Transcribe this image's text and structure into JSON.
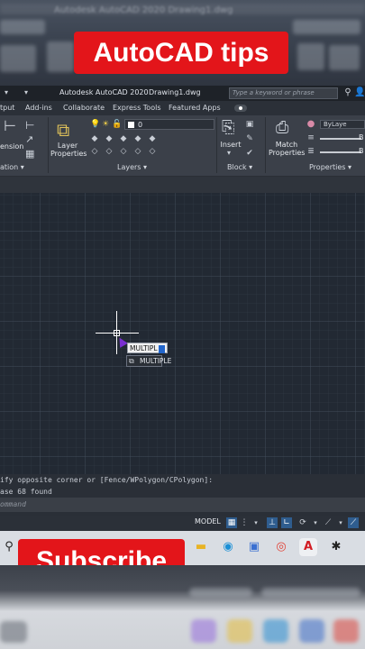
{
  "banner_top": {
    "text": "AutoCAD tips"
  },
  "banner_bottom": {
    "text": "Subscribe"
  },
  "background_blur": {
    "title": "Autodesk AutoCAD 2020  Drawing1.dwg"
  },
  "titlebar": {
    "app_title": "Autodesk AutoCAD 2020",
    "file_name": "Drawing1.dwg",
    "search_placeholder": "Type a keyword or phrase"
  },
  "ribbon_tabs": [
    {
      "label": "tput"
    },
    {
      "label": "Add-ins"
    },
    {
      "label": "Collaborate"
    },
    {
      "label": "Express Tools"
    },
    {
      "label": "Featured Apps"
    }
  ],
  "ribbon": {
    "dimension_label": "ension",
    "annotation_footer": "ation",
    "layer_properties_label_1": "Layer",
    "layer_properties_label_2": "Properties",
    "layer_value": "0",
    "layers_footer": "Layers",
    "insert_label": "Insert",
    "block_footer": "Block",
    "match_properties_label_1": "Match",
    "match_properties_label_2": "Properties",
    "bylayer_value": "ByLaye",
    "prop_b1": "B",
    "prop_b2": "B",
    "properties_footer": "Properties"
  },
  "drawing": {
    "dynamic_input_text": "MULTIPL",
    "autocomplete_item": "MULTIPLE"
  },
  "command": {
    "history_line_1": "ify opposite corner or [Fence/WPolygon/CPolygon]:",
    "history_line_2": "ase 68 found",
    "input_placeholder": "ommand"
  },
  "statusbar": {
    "model_label": "MODEL"
  },
  "colors": {
    "banner_red": "#e3151a",
    "ribbon_bg": "#3b4049",
    "canvas_bg": "#222933",
    "cursor_purple": "#7a2fd0"
  },
  "taskbar_icons": [
    "search-icon",
    "file-explorer-icon",
    "edge-icon",
    "store-icon",
    "chrome-icon",
    "autocad-icon",
    "app-icon"
  ]
}
